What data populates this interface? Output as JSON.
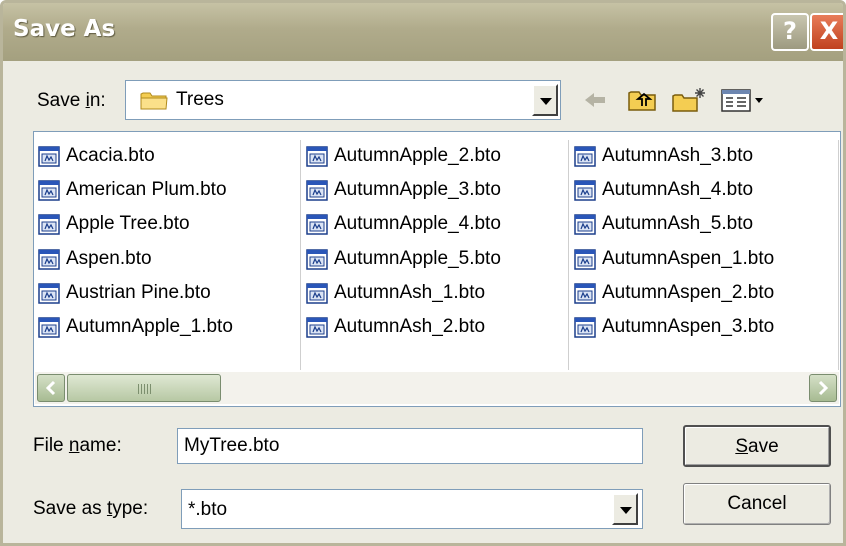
{
  "window": {
    "title": "Save As",
    "help_glyph": "?",
    "close_glyph": "X"
  },
  "toolbar": {
    "save_in_label": "Save in:",
    "save_in_accel": "i",
    "save_in_value": "Trees",
    "icons": [
      "back-arrow-icon",
      "up-one-level-icon",
      "new-folder-icon",
      "views-menu-icon"
    ]
  },
  "files": [
    [
      "Acacia.bto",
      "American Plum.bto",
      "Apple Tree.bto",
      "Aspen.bto",
      "Austrian Pine.bto",
      "AutumnApple_1.bto"
    ],
    [
      "AutumnApple_2.bto",
      "AutumnApple_3.bto",
      "AutumnApple_4.bto",
      "AutumnApple_5.bto",
      "AutumnAsh_1.bto",
      "AutumnAsh_2.bto"
    ],
    [
      "AutumnAsh_3.bto",
      "AutumnAsh_4.bto",
      "AutumnAsh_5.bto",
      "AutumnAspen_1.bto",
      "AutumnAspen_2.bto",
      "AutumnAspen_3.bto"
    ]
  ],
  "form": {
    "file_name_label_pre": "File ",
    "file_name_label_accel": "n",
    "file_name_label_post": "ame:",
    "file_name_value": "MyTree.bto",
    "save_as_type_label_pre": "Save as ",
    "save_as_type_label_accel": "t",
    "save_as_type_label_post": "ype:",
    "save_as_type_value": "*.bto"
  },
  "buttons": {
    "save_accel": "S",
    "save_rest": "ave",
    "cancel": "Cancel"
  },
  "scroll_position": 0,
  "colors": {
    "titlebar": "#b0ab8b",
    "dialog_bg": "#ecebe2",
    "close_red": "#c0421f",
    "scroll_green": "#a7bb92"
  }
}
